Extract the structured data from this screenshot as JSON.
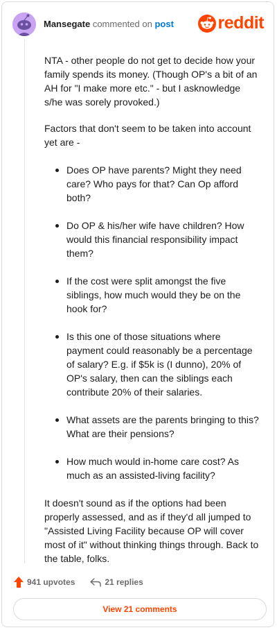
{
  "header": {
    "username": "Mansegate",
    "action_text": "commented on",
    "post_link": "post",
    "logo_text": "reddit"
  },
  "comment": {
    "paragraph_1": "NTA - other people do not get to decide how your family spends its money. (Though OP's a bit of an AH for \"I make more etc.\" - but I asknowledge s/he was sorely provoked.)",
    "paragraph_2": "Factors that don't seem to be taken into account yet are -",
    "bullets": [
      "Does OP have parents? Might they need care? Who pays for that? Can Op afford both?",
      "Do OP & his/her wife have children? How would this financial responsibility impact them?",
      "If the cost were split amongst the five siblings, how much would they be on the hook for?",
      "Is this one of those situations where payment could reasonably be a percentage of salary? E.g. if $5k is (I dunno), 20% of OP's salary, then can the siblings each contribute 20% of their salaries.",
      "What assets are the parents bringing to this? What are their pensions?",
      "How much would in-home care cost? As much as an assisted-living facility?"
    ],
    "paragraph_3": "It doesn't sound as if the options had been properly assessed, and as if they'd all jumped to \"Assisted Living Facility because OP will cover most of it\" without thinking things through. Back to the table, folks."
  },
  "actions": {
    "upvotes": "941 upvotes",
    "replies": "21 replies",
    "view_comments": "View 21 comments"
  },
  "colors": {
    "brand": "#ff4500",
    "link": "#0079d3",
    "avatar_bg": "#c8a4f2"
  },
  "icons": [
    "snoo-avatar-icon",
    "reddit-logo-icon",
    "upvote-arrow-icon",
    "reply-arrow-icon"
  ]
}
